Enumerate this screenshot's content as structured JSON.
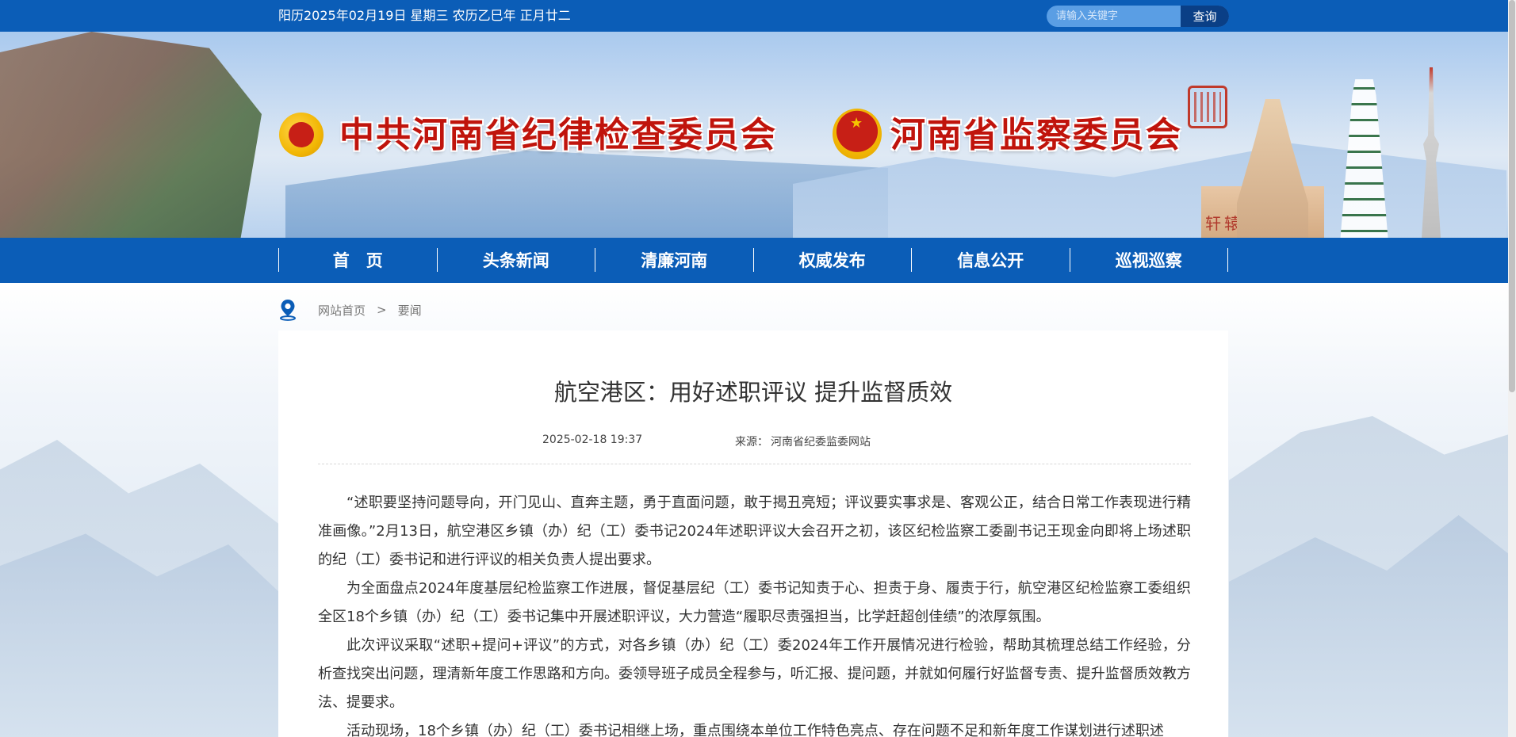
{
  "topbar": {
    "date": "阳历2025年02月19日 星期三 农历乙巳年 正月廿二",
    "search_placeholder": "请输入关键字",
    "search_button": "查询"
  },
  "banner": {
    "left_title": "中共河南省纪律检查委员会",
    "right_title": "河南省监察委员会",
    "pedestal_text": "轩辕黄帝"
  },
  "nav": {
    "items": [
      {
        "label": "首　页"
      },
      {
        "label": "头条新闻"
      },
      {
        "label": "清廉河南"
      },
      {
        "label": "权威发布"
      },
      {
        "label": "信息公开"
      },
      {
        "label": "巡视巡察"
      }
    ]
  },
  "breadcrumb": {
    "home": "网站首页",
    "separator": ">",
    "current": "要闻"
  },
  "article": {
    "title": "航空港区：用好述职评议 提升监督质效",
    "date": "2025-02-18 19:37",
    "source_label": "来源：",
    "source": "河南省纪委监委网站",
    "paragraphs": [
      "“述职要坚持问题导向，开门见山、直奔主题，勇于直面问题，敢于揭丑亮短；评议要实事求是、客观公正，结合日常工作表现进行精准画像。”2月13日，航空港区乡镇（办）纪（工）委书记2024年述职评议大会召开之初，该区纪检监察工委副书记王现金向即将上场述职的纪（工）委书记和进行评议的相关负责人提出要求。",
      "为全面盘点2024年度基层纪检监察工作进展，督促基层纪（工）委书记知责于心、担责于身、履责于行，航空港区纪检监察工委组织全区18个乡镇（办）纪（工）委书记集中开展述职评议，大力营造“履职尽责强担当，比学赶超创佳绩”的浓厚氛围。",
      "此次评议采取“述职+提问+评议”的方式，对各乡镇（办）纪（工）委2024年工作开展情况进行检验，帮助其梳理总结工作经验，分析查找突出问题，理清新年度工作思路和方向。委领导班子成员全程参与，听汇报、提问题，并就如何履行好监督专责、提升监督质效教方法、提要求。",
      "活动现场，18个乡镇（办）纪（工）委书记相继上场，重点围绕本单位工作特色亮点、存在问题不足和新年度工作谋划进行述职述"
    ]
  },
  "colors": {
    "primary_blue": "#0b5db7",
    "title_red": "#c0140c"
  }
}
